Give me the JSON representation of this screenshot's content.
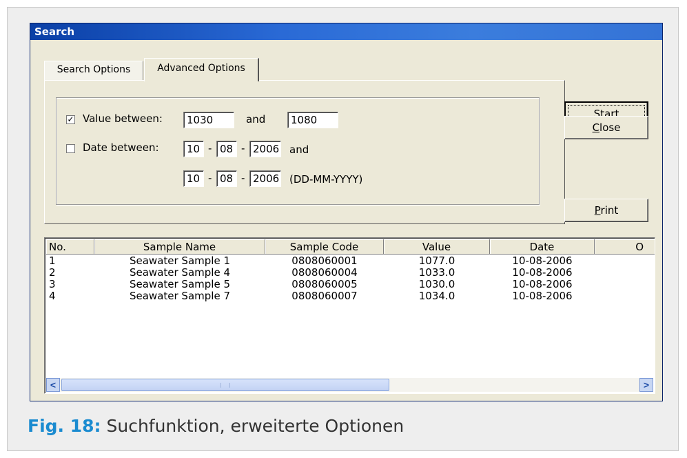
{
  "dialog": {
    "title": "Search"
  },
  "tabs": [
    {
      "label": "Search Options",
      "selected": false
    },
    {
      "label": "Advanced Options",
      "selected": true
    }
  ],
  "filters": {
    "value": {
      "checked": true,
      "label": "Value between:",
      "from": "1030",
      "and_label": "and",
      "to": "1080"
    },
    "date": {
      "checked": false,
      "label": "Date between:",
      "and_label": "and",
      "from": {
        "day": "10",
        "month": "08",
        "year": "2006"
      },
      "to": {
        "day": "10",
        "month": "08",
        "year": "2006"
      },
      "separator": "-",
      "format_hint": "(DD-MM-YYYY)"
    },
    "check_mark": "✓"
  },
  "buttons": {
    "start": "Start",
    "close": "Close",
    "print": "Print"
  },
  "table": {
    "columns": [
      "No.",
      "Sample Name",
      "Sample Code",
      "Value",
      "Date",
      "O"
    ],
    "rows": [
      [
        "1",
        "Seawater Sample 1",
        "0808060001",
        "1077.0",
        "10-08-2006"
      ],
      [
        "2",
        "Seawater Sample 4",
        "0808060004",
        "1033.0",
        "10-08-2006"
      ],
      [
        "3",
        "Seawater Sample 5",
        "0808060005",
        "1030.0",
        "10-08-2006"
      ],
      [
        "4",
        "Seawater Sample 7",
        "0808060007",
        "1034.0",
        "10-08-2006"
      ]
    ]
  },
  "scrollbar": {
    "left_arrow": "<",
    "right_arrow": ">"
  },
  "caption": {
    "fig": "Fig. 18:",
    "text": "Suchfunktion, erweiterte Optionen"
  },
  "colors": {
    "titlebar": "#2a6ad6",
    "caption_accent": "#1a8bd0",
    "dialog_bg": "#ece9d8"
  }
}
